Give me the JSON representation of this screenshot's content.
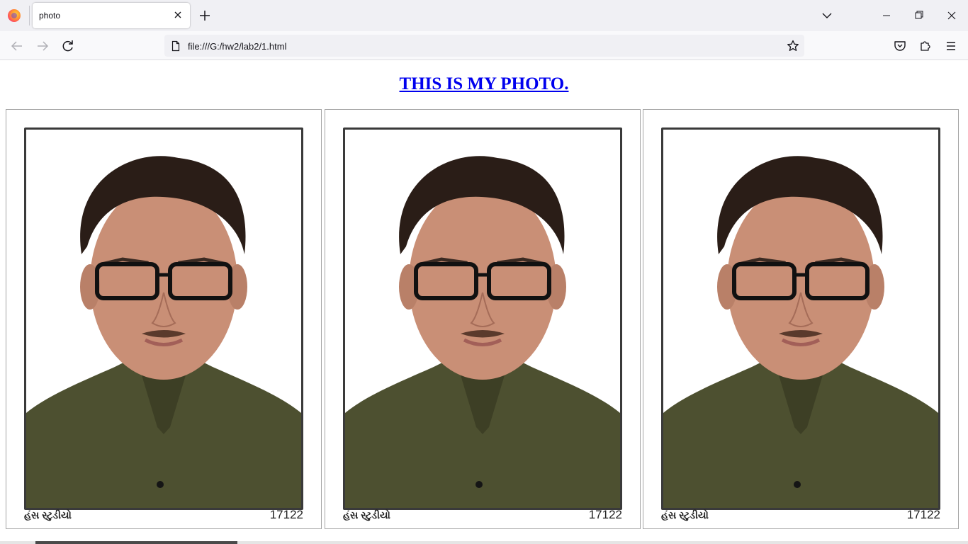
{
  "browser": {
    "tab_title": "photo",
    "url": "file:///G:/hw2/lab2/1.html"
  },
  "page": {
    "heading": "THIS IS MY PHOTO.",
    "photos": [
      {
        "studio": "હંસ સ્ટુડીયો",
        "code": "17122"
      },
      {
        "studio": "હંસ સ્ટુડીયો",
        "code": "17122"
      },
      {
        "studio": "હંસ સ્ટુડીયો",
        "code": "17122"
      }
    ]
  },
  "icons": {
    "browser_logo": "firefox-icon",
    "tab_close": "close-icon",
    "new_tab": "plus-icon",
    "list_tabs": "chevron-down-icon",
    "back": "arrow-left-icon",
    "forward": "arrow-right-icon",
    "reload": "reload-icon",
    "page": "page-icon",
    "bookmark": "star-icon",
    "pocket": "pocket-icon",
    "extensions": "puzzle-icon",
    "menu": "hamburger-icon"
  },
  "colors": {
    "link": "#0000ee",
    "shirt": "#4d5030",
    "skin": "#c98f76",
    "hair": "#2a1d17"
  }
}
